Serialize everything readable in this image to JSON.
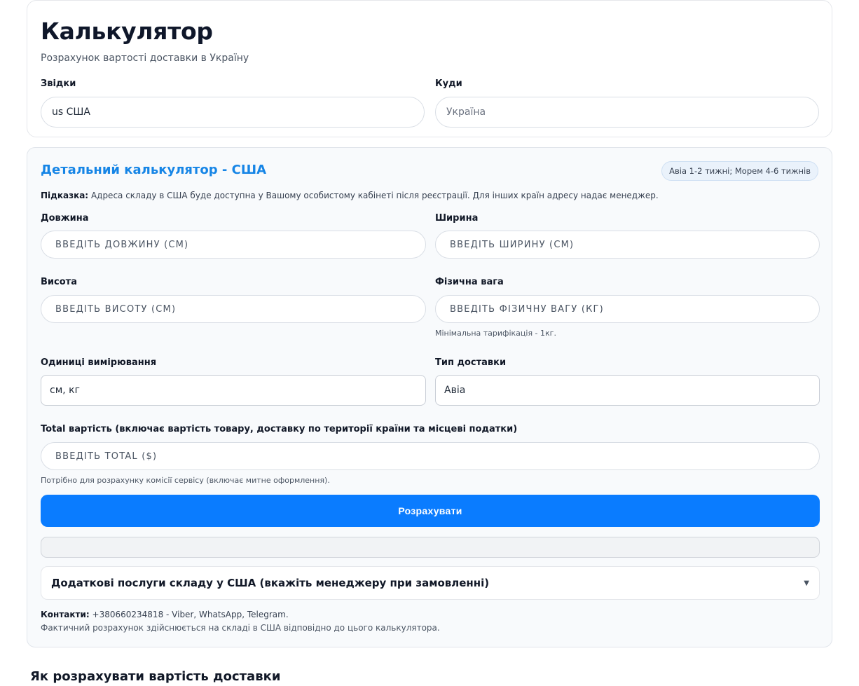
{
  "header": {
    "title": "Калькулятор",
    "subtitle": "Розрахунок вартості доставки в Україну",
    "from_label": "Звідки",
    "from_value": "us США",
    "to_label": "Куди",
    "to_placeholder": "Україна"
  },
  "calc": {
    "title": "Детальний калькулятор - США",
    "badge": "Авіа 1-2 тижні; Морем 4-6 тижнів",
    "hint_label": "Підказка:",
    "hint_text": "Адреса складу в США буде доступна у Вашому особистому кабінеті після реєстрації. Для інших країн адресу надає менеджер.",
    "length_label": "Довжина",
    "length_placeholder": "Введіть довжину (см)",
    "width_label": "Ширина",
    "width_placeholder": "Введіть ширину (см)",
    "height_label": "Висота",
    "height_placeholder": "Введіть висоту (см)",
    "weight_label": "Фізична вага",
    "weight_placeholder": "Введіть фізичну вагу (кг)",
    "weight_note": "Мінімальна тарифікація - 1кг.",
    "units_label": "Одиниці вимірювання",
    "units_value": "см, кг",
    "delivery_label": "Тип доставки",
    "delivery_value": "Авіа",
    "total_label": "Total вартість (включає вартість товару, доставку по території країни та місцеві податки)",
    "total_placeholder": "Введіть Total ($)",
    "total_note": "Потрібно для розрахунку комісії сервісу (включає митне оформлення).",
    "calculate_button": "Розрахувати",
    "extra_services": "Додаткові послуги складу у США (вкажіть менеджеру при замовленні)",
    "contacts_label": "Контакти:",
    "contacts_text": "+380660234818 - Viber, WhatsApp, Telegram.",
    "fact_text": "Фактичний розрахунок здійснюється на складі в США відповідно до цього калькулятора."
  },
  "footer": {
    "heading": "Як розрахувати вартість доставки"
  },
  "colors": {
    "accent": "#0a7cff",
    "calc_title": "#1685e6"
  }
}
